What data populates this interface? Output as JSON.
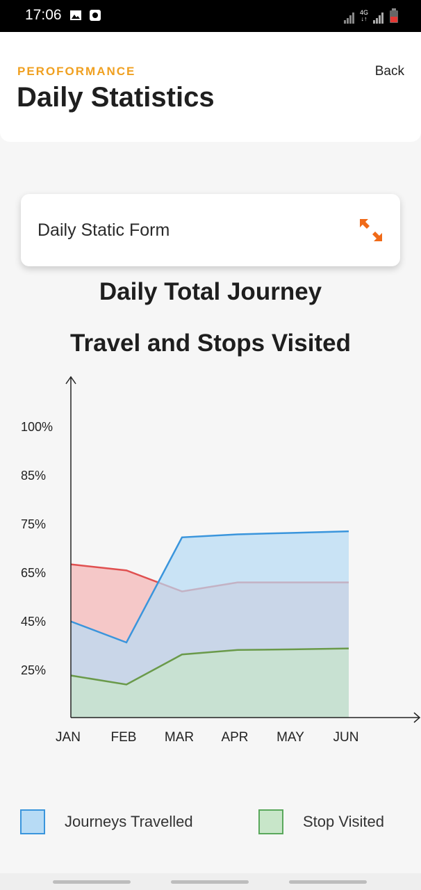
{
  "status_bar": {
    "time": "17:06",
    "network_label": "4G",
    "icons": [
      "image-icon",
      "record-icon",
      "signal-icon",
      "signal-icon",
      "battery-icon"
    ]
  },
  "header": {
    "overline": "PEROFORMANCE",
    "title": "Daily Statistics",
    "back_label": "Back"
  },
  "form_card": {
    "label": "Daily Static Form",
    "icon": "expand-arrows-icon",
    "icon_color": "#f06a18"
  },
  "chart_title": {
    "line1": "Daily Total Journey",
    "line2": "Travel and Stops Visited"
  },
  "chart_data": {
    "type": "area",
    "categories": [
      "JAN",
      "FEB",
      "MAR",
      "APR",
      "MAY",
      "JUN"
    ],
    "y_tick_labels": [
      "25%",
      "45%",
      "65%",
      "75%",
      "85%",
      "100%"
    ],
    "grid": false,
    "series": [
      {
        "color": "#e05050",
        "fill": "#f5b5b5",
        "values": [
          51,
          49,
          42,
          45,
          45,
          45
        ]
      },
      {
        "color": "#3a95dc",
        "fill": "#b7dbf5",
        "values": [
          32,
          25,
          60,
          61,
          61.5,
          62
        ]
      },
      {
        "color": "#6a9a4a",
        "fill": "#c8e6c9",
        "values": [
          14,
          11,
          21,
          22.5,
          22.7,
          23
        ]
      }
    ]
  },
  "legend": {
    "items": [
      {
        "label": "Journeys Travelled",
        "fill": "#b7dbf5",
        "border": "#3a95dc"
      },
      {
        "label": "Stop Visited",
        "fill": "#c8e6c9",
        "border": "#5aa85c"
      }
    ]
  }
}
